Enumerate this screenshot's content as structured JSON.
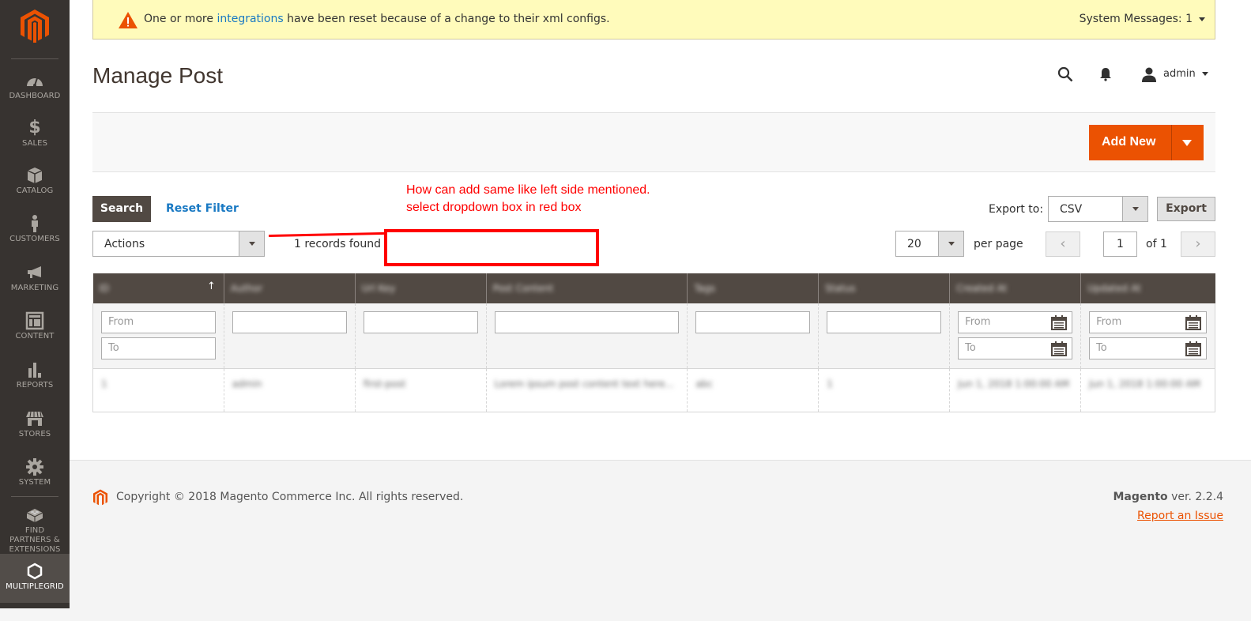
{
  "sidebar": {
    "items": [
      {
        "label": "DASHBOARD",
        "icon": "dashboard-icon"
      },
      {
        "label": "SALES",
        "icon": "dollar-icon"
      },
      {
        "label": "CATALOG",
        "icon": "box-icon"
      },
      {
        "label": "CUSTOMERS",
        "icon": "person-icon"
      },
      {
        "label": "MARKETING",
        "icon": "megaphone-icon"
      },
      {
        "label": "CONTENT",
        "icon": "layout-icon"
      },
      {
        "label": "REPORTS",
        "icon": "bar-chart-icon"
      },
      {
        "label": "STORES",
        "icon": "storefront-icon"
      },
      {
        "label": "SYSTEM",
        "icon": "gear-icon"
      },
      {
        "label": "FIND PARTNERS & EXTENSIONS",
        "icon": "lego-block-icon"
      },
      {
        "label": "MULTIPLEGRID",
        "icon": "hexagon-icon",
        "active": true
      }
    ]
  },
  "system_message": {
    "text_before": "One or more ",
    "link": "integrations",
    "text_after": " have been reset because of a change to their xml configs.",
    "count_label": "System Messages: 1"
  },
  "header": {
    "title": "Manage Post",
    "user": "admin"
  },
  "actions_bar": {
    "add_new": "Add New"
  },
  "toolbar": {
    "search": "Search",
    "reset_filter": "Reset Filter",
    "actions_select": "Actions",
    "records_found": "1 records found",
    "export_label": "Export to:",
    "export_format": "CSV",
    "export_button": "Export",
    "per_page_value": "20",
    "per_page_label": "per page",
    "page_current": "1",
    "page_of": "of 1",
    "prev": "‹",
    "next": "›"
  },
  "annotation": {
    "line1": "How can add same like left side mentioned.",
    "line2": "select dropdown box in red box"
  },
  "grid": {
    "columns": [
      "ID",
      "Author",
      "Url Key",
      "Post Content",
      "Tags",
      "Status",
      "Created At",
      "Updated At"
    ],
    "sort_indicator": "↑",
    "filters": {
      "from": "From",
      "to": "To"
    },
    "rows": [
      [
        "1",
        "admin",
        "first-post",
        "Lorem ipsum post content text here...",
        "abc",
        "1",
        "Jun 1, 2018 1:00:00 AM",
        "Jun 1, 2018 1:00:00 AM"
      ]
    ]
  },
  "footer": {
    "copyright": "Copyright © 2018 Magento Commerce Inc. All rights reserved.",
    "brand": "Magento",
    "version": " ver. 2.2.4",
    "report": "Report an Issue"
  },
  "colors": {
    "brand_orange": "#eb5202",
    "sidebar_bg": "#373330",
    "grid_header": "#514943",
    "link_blue": "#1979c3",
    "annotation_red": "#ff0000"
  }
}
